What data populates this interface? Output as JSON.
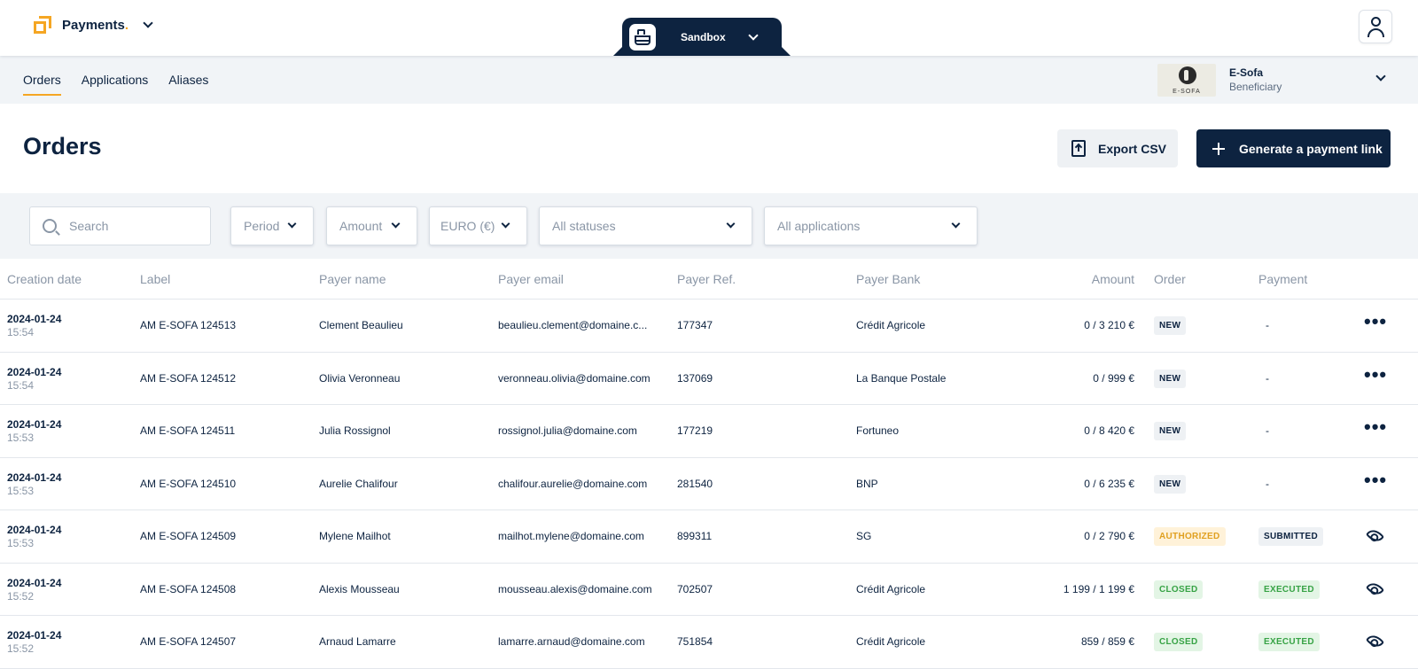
{
  "app": {
    "brand": "Payments",
    "brand_dot": ".",
    "environment": "Sandbox"
  },
  "nav": {
    "tabs": [
      {
        "label": "Orders",
        "active": true
      },
      {
        "label": "Applications",
        "active": false
      },
      {
        "label": "Aliases",
        "active": false
      }
    ]
  },
  "account": {
    "logo_text": "E-SOFA",
    "name": "E-Sofa",
    "role": "Beneficiary"
  },
  "page": {
    "title": "Orders",
    "export_label": "Export CSV",
    "generate_label": "Generate a payment link"
  },
  "filters": {
    "search_placeholder": "Search",
    "period": "Period",
    "amount": "Amount",
    "currency": "EURO (€)",
    "statuses": "All statuses",
    "applications": "All applications"
  },
  "table": {
    "headers": {
      "creation_date": "Creation date",
      "label": "Label",
      "payer_name": "Payer name",
      "payer_email": "Payer email",
      "payer_ref": "Payer Ref.",
      "payer_bank": "Payer Bank",
      "amount": "Amount",
      "order": "Order",
      "payment": "Payment"
    },
    "rows": [
      {
        "date": "2024-01-24",
        "time": "15:54",
        "label": "AM E-SOFA 124513",
        "payer_name": "Clement Beaulieu",
        "payer_email": "beaulieu.clement@domaine.c...",
        "payer_ref": "177347",
        "payer_bank": "Crédit Agricole",
        "amount": "0 / 3 210 €",
        "order": "NEW",
        "payment": "-"
      },
      {
        "date": "2024-01-24",
        "time": "15:54",
        "label": "AM E-SOFA 124512",
        "payer_name": "Olivia Veronneau",
        "payer_email": "veronneau.olivia@domaine.com",
        "payer_ref": "137069",
        "payer_bank": "La Banque Postale",
        "amount": "0 / 999 €",
        "order": "NEW",
        "payment": "-"
      },
      {
        "date": "2024-01-24",
        "time": "15:53",
        "label": "AM E-SOFA 124511",
        "payer_name": "Julia Rossignol",
        "payer_email": "rossignol.julia@domaine.com",
        "payer_ref": "177219",
        "payer_bank": "Fortuneo",
        "amount": "0 / 8 420 €",
        "order": "NEW",
        "payment": "-"
      },
      {
        "date": "2024-01-24",
        "time": "15:53",
        "label": "AM E-SOFA 124510",
        "payer_name": "Aurelie Chalifour",
        "payer_email": "chalifour.aurelie@domaine.com",
        "payer_ref": "281540",
        "payer_bank": "BNP",
        "amount": "0 / 6 235 €",
        "order": "NEW",
        "payment": "-"
      },
      {
        "date": "2024-01-24",
        "time": "15:53",
        "label": "AM E-SOFA 124509",
        "payer_name": "Mylene Mailhot",
        "payer_email": "mailhot.mylene@domaine.com",
        "payer_ref": "899311",
        "payer_bank": "SG",
        "amount": "0 / 2 790 €",
        "order": "AUTHORIZED",
        "payment": "SUBMITTED"
      },
      {
        "date": "2024-01-24",
        "time": "15:52",
        "label": "AM E-SOFA 124508",
        "payer_name": "Alexis Mousseau",
        "payer_email": "mousseau.alexis@domaine.com",
        "payer_ref": "702507",
        "payer_bank": "Crédit Agricole",
        "amount": "1 199 / 1 199 €",
        "order": "CLOSED",
        "payment": "EXECUTED"
      },
      {
        "date": "2024-01-24",
        "time": "15:52",
        "label": "AM E-SOFA 124507",
        "payer_name": "Arnaud Lamarre",
        "payer_email": "lamarre.arnaud@domaine.com",
        "payer_ref": "751854",
        "payer_bank": "Crédit Agricole",
        "amount": "859 / 859 €",
        "order": "CLOSED",
        "payment": "EXECUTED"
      }
    ]
  },
  "colors": {
    "primary": "#0d2340",
    "accent": "#f5a623",
    "surface": "#f1f4f7"
  }
}
